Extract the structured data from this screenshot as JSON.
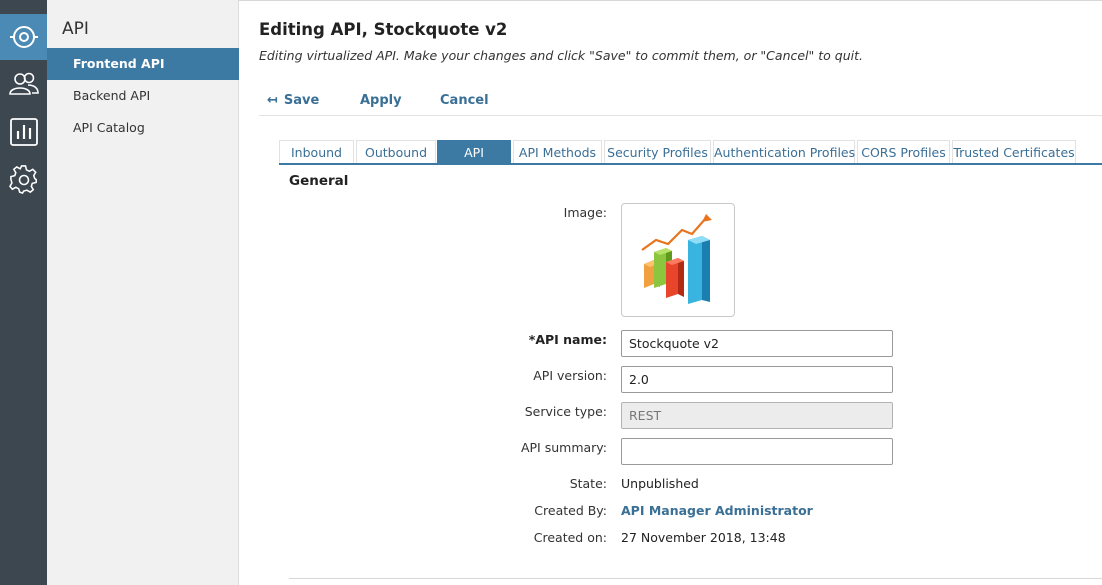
{
  "rail": {
    "items": [
      {
        "icon": "api-icon",
        "active": true
      },
      {
        "icon": "users-icon",
        "active": false
      },
      {
        "icon": "bar-chart-icon",
        "active": false
      },
      {
        "icon": "gear-icon",
        "active": false
      }
    ]
  },
  "subnav": {
    "title": "API",
    "items": [
      {
        "label": "Frontend API",
        "active": true
      },
      {
        "label": "Backend API",
        "active": false
      },
      {
        "label": "API Catalog",
        "active": false
      }
    ]
  },
  "header": {
    "title": "Editing API, Stockquote v2",
    "subtitle": "Editing virtualized API. Make your changes and click \"Save\" to commit them, or \"Cancel\" to quit."
  },
  "toolbar": {
    "save_icon": "↤",
    "save_label": "Save",
    "apply_label": "Apply",
    "cancel_label": "Cancel"
  },
  "tabs": [
    {
      "label": "Inbound",
      "active": false
    },
    {
      "label": "Outbound",
      "active": false
    },
    {
      "label": "API",
      "active": true
    },
    {
      "label": "API Methods",
      "active": false
    },
    {
      "label": "Security Profiles",
      "active": false
    },
    {
      "label": "Authentication Profiles",
      "active": false
    },
    {
      "label": "CORS Profiles",
      "active": false
    },
    {
      "label": "Trusted Certificates",
      "active": false
    }
  ],
  "general": {
    "section_title": "General",
    "image_label": "Image:",
    "image_icon": "bar-chart-growth-image",
    "api_name_label": "*API name:",
    "api_name_value": "Stockquote v2",
    "api_version_label": "API version:",
    "api_version_value": "2.0",
    "service_type_label": "Service type:",
    "service_type_value": "REST",
    "api_summary_label": "API summary:",
    "api_summary_value": "",
    "state_label": "State:",
    "state_value": "Unpublished",
    "created_by_label": "Created By:",
    "created_by_value": "API Manager Administrator",
    "created_on_label": "Created on:",
    "created_on_value": "27 November 2018, 13:48"
  },
  "colors": {
    "rail_bg": "#3d4750",
    "rail_active": "#4a8ab4",
    "accent": "#3d7aa3",
    "link": "#3a6f96"
  }
}
